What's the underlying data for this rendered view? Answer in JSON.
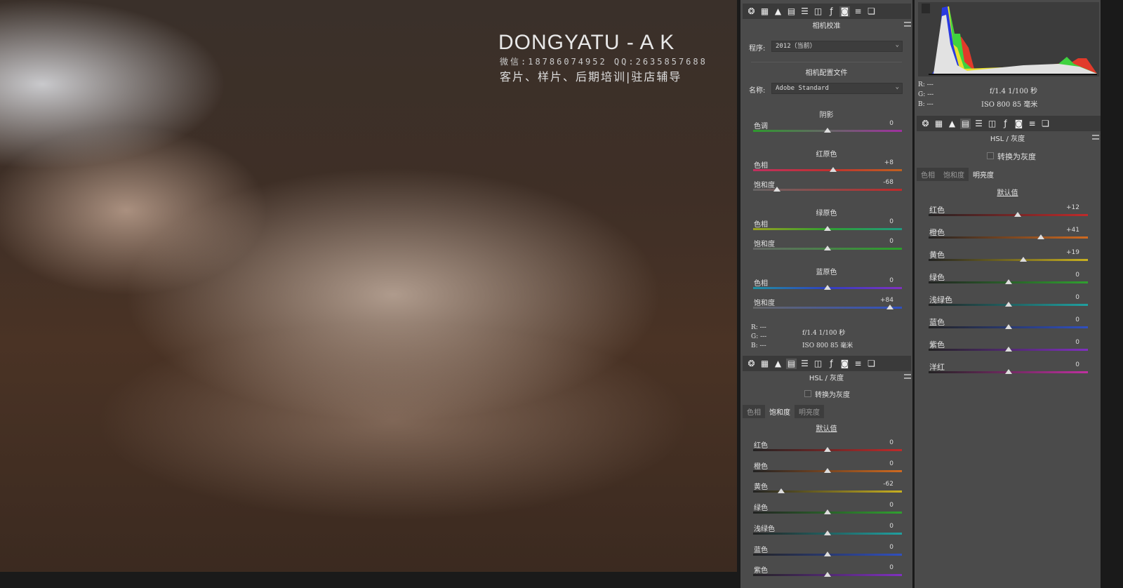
{
  "watermark": {
    "brand": "DONGYATU - A K",
    "contact": "微信:18786074952   QQ:2635857688",
    "services": "客片、样片、后期培训|驻店辅导"
  },
  "toolbar_icons": [
    "aperture-icon",
    "curve-grid-icon",
    "mountain-icon",
    "hsl-icon",
    "split-tone-icon",
    "detail-icon",
    "fx-icon",
    "camera-icon",
    "presets-icon",
    "snapshots-icon"
  ],
  "mid": {
    "title": "相机校准",
    "process_label": "程序:",
    "process_value": "2012（当前）",
    "profile_heading": "相机配置文件",
    "name_label": "名称:",
    "name_value": "Adobe Standard",
    "groups": [
      {
        "heading": "阴影",
        "sliders": [
          {
            "label": "色调",
            "value": 0,
            "display": "0",
            "track": "linear-gradient(90deg,#2e9a2e,#666 50%,#a030a0)"
          }
        ]
      },
      {
        "heading": "红原色",
        "sliders": [
          {
            "label": "色相",
            "value": 8,
            "display": "+8",
            "track": "linear-gradient(90deg,#c03060,#c03030 50%,#c06020)"
          },
          {
            "label": "饱和度",
            "value": -68,
            "display": "-68",
            "track": "linear-gradient(90deg,#666,#c02a2a)"
          }
        ]
      },
      {
        "heading": "绿原色",
        "sliders": [
          {
            "label": "色相",
            "value": 0,
            "display": "0",
            "track": "linear-gradient(90deg,#9aa020,#30a030 50%,#209a80)"
          },
          {
            "label": "饱和度",
            "value": 0,
            "display": "0",
            "track": "linear-gradient(90deg,#666,#2aa02a)"
          }
        ]
      },
      {
        "heading": "蓝原色",
        "sliders": [
          {
            "label": "色相",
            "value": 0,
            "display": "0",
            "track": "linear-gradient(90deg,#2090a0,#3040c0 50%,#8030c0)"
          },
          {
            "label": "饱和度",
            "value": 84,
            "display": "+84",
            "track": "linear-gradient(90deg,#666,#3050c0)"
          }
        ]
      }
    ],
    "info": {
      "r": "R:  ---",
      "g": "G:  ---",
      "b": "B:  ---",
      "exposure": "f/1.4   1/100 秒",
      "iso": "ISO 800   85 毫米"
    },
    "hsl_title": "HSL / 灰度",
    "grayscale_label": "转换为灰度",
    "tabs": [
      "色相",
      "饱和度",
      "明亮度"
    ],
    "active_tab": 1,
    "default_label": "默认值",
    "sliders": [
      {
        "label": "红色",
        "value": 0,
        "display": "0"
      },
      {
        "label": "橙色",
        "value": 0,
        "display": "0"
      },
      {
        "label": "黄色",
        "value": -62,
        "display": "-62"
      },
      {
        "label": "绿色",
        "value": 0,
        "display": "0"
      },
      {
        "label": "浅绿色",
        "value": 0,
        "display": "0"
      },
      {
        "label": "蓝色",
        "value": 0,
        "display": "0"
      },
      {
        "label": "紫色",
        "value": 0,
        "display": "0"
      }
    ]
  },
  "right": {
    "info": {
      "r": "R:  ---",
      "g": "G:  ---",
      "b": "B:  ---",
      "exposure": "f/1.4   1/100 秒",
      "iso": "ISO 800   85 毫米"
    },
    "hsl_title": "HSL / 灰度",
    "grayscale_label": "转换为灰度",
    "tabs": [
      "色相",
      "饱和度",
      "明亮度"
    ],
    "active_tab": 2,
    "default_label": "默认值",
    "sliders": [
      {
        "label": "红色",
        "value": 12,
        "display": "+12"
      },
      {
        "label": "橙色",
        "value": 41,
        "display": "+41"
      },
      {
        "label": "黄色",
        "value": 19,
        "display": "+19"
      },
      {
        "label": "绿色",
        "value": 0,
        "display": "0"
      },
      {
        "label": "浅绿色",
        "value": 0,
        "display": "0"
      },
      {
        "label": "蓝色",
        "value": 0,
        "display": "0"
      },
      {
        "label": "紫色",
        "value": 0,
        "display": "0"
      },
      {
        "label": "洋红",
        "value": 0,
        "display": "0"
      }
    ]
  },
  "hsl_tracks": {
    "红色": "linear-gradient(90deg,#222,#c02a2a)",
    "橙色": "linear-gradient(90deg,#222,#d06a20)",
    "黄色": "linear-gradient(90deg,#222,#c8b020)",
    "绿色": "linear-gradient(90deg,#222,#30a030)",
    "浅绿色": "linear-gradient(90deg,#222,#20a0a0)",
    "蓝色": "linear-gradient(90deg,#222,#3050c0)",
    "紫色": "linear-gradient(90deg,#222,#8030c0)",
    "洋红": "linear-gradient(90deg,#222,#c030a0)"
  }
}
